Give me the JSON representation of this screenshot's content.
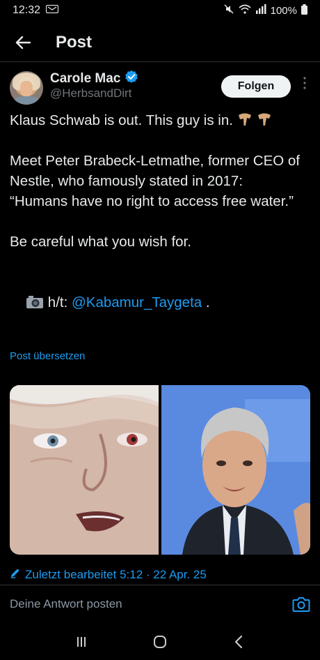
{
  "statusbar": {
    "time": "12:32",
    "battery": "100%"
  },
  "header": {
    "title": "Post"
  },
  "author": {
    "name": "Carole Mac",
    "handle": "@HerbsandDirt",
    "follow_label": "Folgen"
  },
  "tweet": {
    "line1": "Klaus Schwab is out. This guy is in.",
    "para2": "Meet Peter Brabeck-Letmathe, former CEO of Nestle, who famously stated in 2017:\n“Humans have no right to access free water.”",
    "para3": "Be careful what you wish for.",
    "ht_prefix": "h/t: ",
    "mention": "@Kabamur_Taygeta",
    "ht_suffix": " ."
  },
  "translate_label": "Post übersetzen",
  "edited_label": "Zuletzt bearbeitet 5:12 · 22 Apr. 25",
  "reply_placeholder": "Deine Antwort posten",
  "colors": {
    "accent": "#1d9bf0",
    "background": "#000000",
    "text": "#e7e9ea",
    "muted": "#71767b"
  },
  "icons": [
    "back-arrow-icon",
    "verified-badge-icon",
    "more-icon",
    "camera-icon",
    "pencil-icon",
    "recent-apps-icon",
    "home-icon",
    "back-nav-icon"
  ]
}
